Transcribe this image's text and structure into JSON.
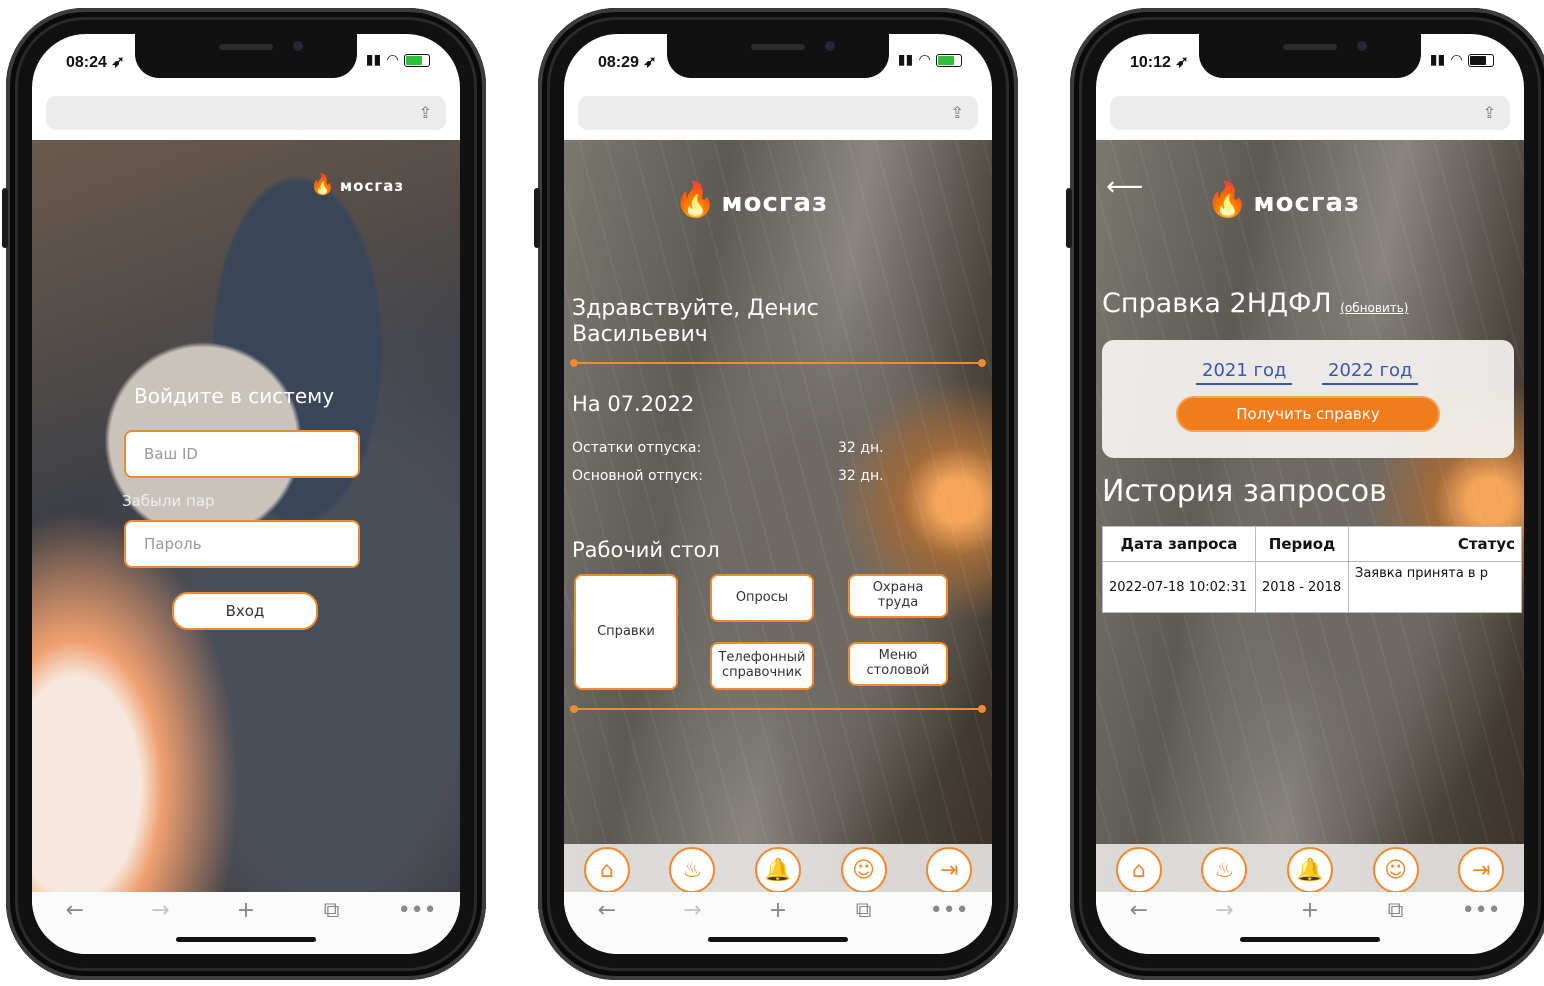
{
  "colors": {
    "accent": "#f07c1c",
    "link": "#3a56b8"
  },
  "logo_text": "мосгаз",
  "safari_toolbar": [
    "←",
    "→",
    "+",
    "⧉",
    "•••"
  ],
  "phone1": {
    "time": "08:24 ➶",
    "login_title": "Войдите в систему",
    "id_placeholder": "Ваш ID",
    "forgot_text": "Забыли пар",
    "password_placeholder": "Пароль",
    "login_button": "Вход"
  },
  "phone2": {
    "time": "08:29 ➶",
    "greeting": "Здравствуйте, Денис Васильевич",
    "date_heading": "На 07.2022",
    "vacation_rows": [
      {
        "label": "Остатки отпуска:",
        "value": "32 дн."
      },
      {
        "label": "Основной отпуск:",
        "value": "32 дн."
      }
    ],
    "desktop_heading": "Рабочий стол",
    "tiles": {
      "spravki": "Справки",
      "oprosy": "Опросы",
      "okhrana": "Охрана труда",
      "phonebook": "Телефонный справочник",
      "menu": "Меню столовой"
    }
  },
  "phone3": {
    "time": "10:12 ➶",
    "title": "Справка 2НДФЛ",
    "refresh_link": "(обновить)",
    "years": [
      "2021 год",
      "2022 год"
    ],
    "get_button": "Получить справку",
    "history_title": "История запросов",
    "table_headers": [
      "Дата запроса",
      "Период",
      "Статус"
    ],
    "table_rows": [
      [
        "2022-07-18 10:02:31",
        "2018 - 2018",
        "Заявка принята в р"
      ]
    ]
  }
}
